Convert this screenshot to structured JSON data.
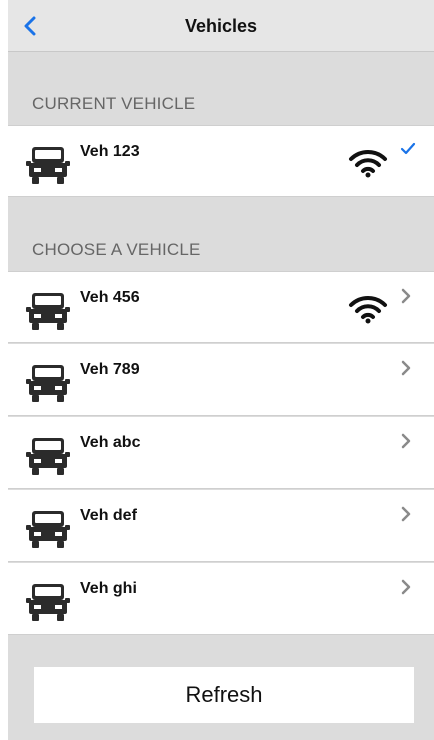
{
  "header": {
    "title": "Vehicles",
    "back_icon": "chevron-left-icon"
  },
  "sections": {
    "current": {
      "title": "CURRENT VEHICLE"
    },
    "choose": {
      "title": "CHOOSE A VEHICLE"
    }
  },
  "current_vehicle": {
    "label": "Veh 123",
    "connected": true,
    "selected": true
  },
  "vehicles": [
    {
      "label": "Veh 456",
      "connected": true
    },
    {
      "label": "Veh 789",
      "connected": false
    },
    {
      "label": "Veh abc",
      "connected": false
    },
    {
      "label": "Veh def",
      "connected": false
    },
    {
      "label": "Veh ghi",
      "connected": false
    }
  ],
  "actions": {
    "refresh_label": "Refresh"
  },
  "colors": {
    "accent": "#1a73e8",
    "background": "#dcdcdc",
    "icon": "#2b2b2b"
  }
}
